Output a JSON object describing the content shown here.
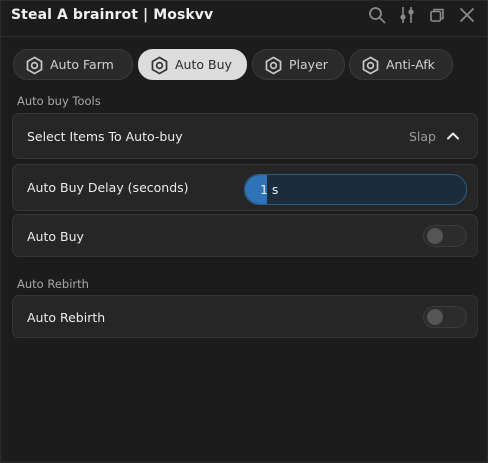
{
  "window": {
    "title": "Steal A brainrot | Moskvv"
  },
  "titlebar_icons": [
    "search-icon",
    "sliders-icon",
    "copy-icon",
    "close-icon"
  ],
  "tabs": [
    {
      "label": "Auto Farm",
      "icon": "gear-icon",
      "active": false
    },
    {
      "label": "Auto Buy",
      "icon": "gear-icon",
      "active": true
    },
    {
      "label": "Player",
      "icon": "gear-icon",
      "active": false
    },
    {
      "label": "Anti-Afk",
      "icon": "gear-icon",
      "active": false
    }
  ],
  "sections": {
    "auto_buy_tools": {
      "label": "Auto buy Tools",
      "dropdown": {
        "label": "Select Items To Auto-buy",
        "value": "Slap",
        "expanded": true
      },
      "slider": {
        "label": "Auto Buy Delay (seconds)",
        "value_text": "1 s",
        "value": 1,
        "fill_fraction": 0.1
      },
      "toggle": {
        "label": "Auto Buy",
        "on": false
      }
    },
    "auto_rebirth": {
      "label": "Auto Rebirth",
      "toggle": {
        "label": "Auto Rebirth",
        "on": false
      }
    }
  },
  "colors": {
    "background": "#1c1c1c",
    "card": "#262626",
    "accent": "#2d73b5",
    "active_tab": "#dcdcdc"
  }
}
